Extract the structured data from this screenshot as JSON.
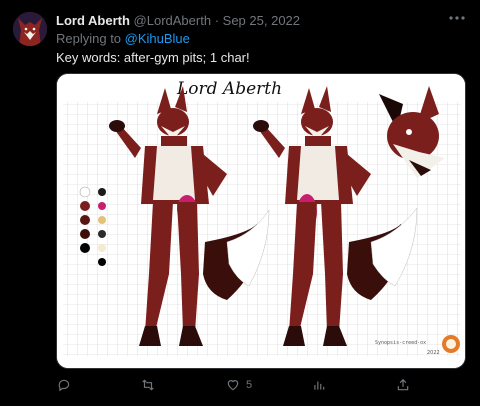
{
  "tweet": {
    "display_name": "Lord Aberth",
    "handle": "@LordAberth",
    "separator": "·",
    "date": "Sep 25, 2022",
    "more_label": "···",
    "replying_prefix": "Replying to ",
    "replying_handle": "@KihuBlue",
    "text": "Key words: after-gym pits; 1 char!"
  },
  "media": {
    "sheet_title": "Lord Aberth",
    "credit": "Synopsis-creed-ox",
    "year": "2022",
    "palette": [
      "#ffffff",
      "#7b1f1c",
      "#5a1512",
      "#3a0e0b",
      "#000000",
      "#e3c27a",
      "#c91e6e",
      "#1a1a1a",
      "#f4ead0",
      "#2b2b2b"
    ]
  },
  "actions": {
    "reply_count": "",
    "retweet_count": "",
    "like_count": "5",
    "views_count": ""
  },
  "colors": {
    "background": "#000000",
    "text": "#e7e9ea",
    "muted": "#71767b",
    "link": "#1d9bf0",
    "fur": "#7b1f1c",
    "dark_fur": "#3a0e0b",
    "accent": "#c91e6e"
  },
  "icons": [
    "more-icon",
    "reply-icon",
    "retweet-icon",
    "like-icon",
    "views-icon",
    "share-icon"
  ]
}
